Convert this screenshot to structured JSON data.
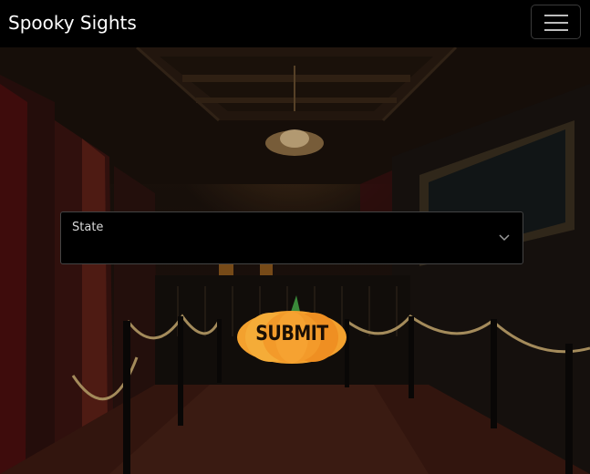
{
  "navbar": {
    "brand": "Spooky Sights",
    "menu_icon": "hamburger-menu-icon"
  },
  "form": {
    "state_label": "State",
    "state_value": "",
    "dropdown_icon": "chevron-down-icon",
    "submit_label": "SUBMIT",
    "submit_style": "pumpkin-button"
  },
  "colors": {
    "navbar_bg": "#000000",
    "select_bg": "#000000",
    "pumpkin_orange": "#f39a2a",
    "pumpkin_stem": "#3a8a3a"
  }
}
